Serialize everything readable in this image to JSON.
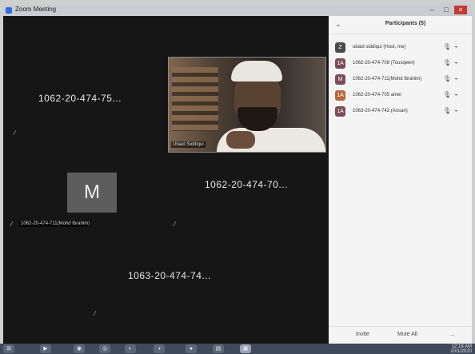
{
  "window": {
    "title": "Zoom Meeting",
    "controls": {
      "minimize": "–",
      "maximize": "□",
      "close": "×"
    }
  },
  "video": {
    "tiles": [
      {
        "label": "1062-20-474-75..."
      },
      {
        "label": "1062-20-474-70..."
      },
      {
        "label": "1063-20-474-74..."
      }
    ],
    "avatar_letter": "M",
    "avatar_name_tag": "1062-20-474-711(Mohd Ibrahim)",
    "self_name_tag": "Ubaid Siddiqui",
    "muted_glyph": "⁄"
  },
  "participants": {
    "title": "Participants (5)",
    "chevron": "⌄",
    "list": [
      {
        "avatar": "Z",
        "avatar_color": "#4a4a4a",
        "name": "ubaid siddiqui (Host, me)",
        "mic": "🎙",
        "cam": "⌁"
      },
      {
        "avatar": "1A",
        "avatar_color": "#7a4d55",
        "name": "1062-20-474-708 (Tousqeen)",
        "mic": "🎙",
        "cam": "⌁"
      },
      {
        "avatar": "M",
        "avatar_color": "#7a4d55",
        "name": "1062-20-474-711(Mohd Ibrahim)",
        "mic": "🎙",
        "cam": "⌁"
      },
      {
        "avatar": "1A",
        "avatar_color": "#b8683a",
        "name": "1062-20-474-705 amer",
        "mic": "🎙",
        "cam": "⌁"
      },
      {
        "avatar": "1A",
        "avatar_color": "#7a4d55",
        "name": "1063-20-474-742 (Ansari)",
        "mic": "🎙",
        "cam": "⌁"
      }
    ],
    "footer": {
      "invite": "Invite",
      "mute_all": "Mute All",
      "more": "..."
    }
  },
  "taskbar": {
    "icons": [
      "⊞",
      "▶",
      "◉",
      "◎",
      "◐",
      "◑",
      "●",
      "▤",
      "▣"
    ],
    "time": "12:18 AM",
    "date": "10/1/2020"
  }
}
